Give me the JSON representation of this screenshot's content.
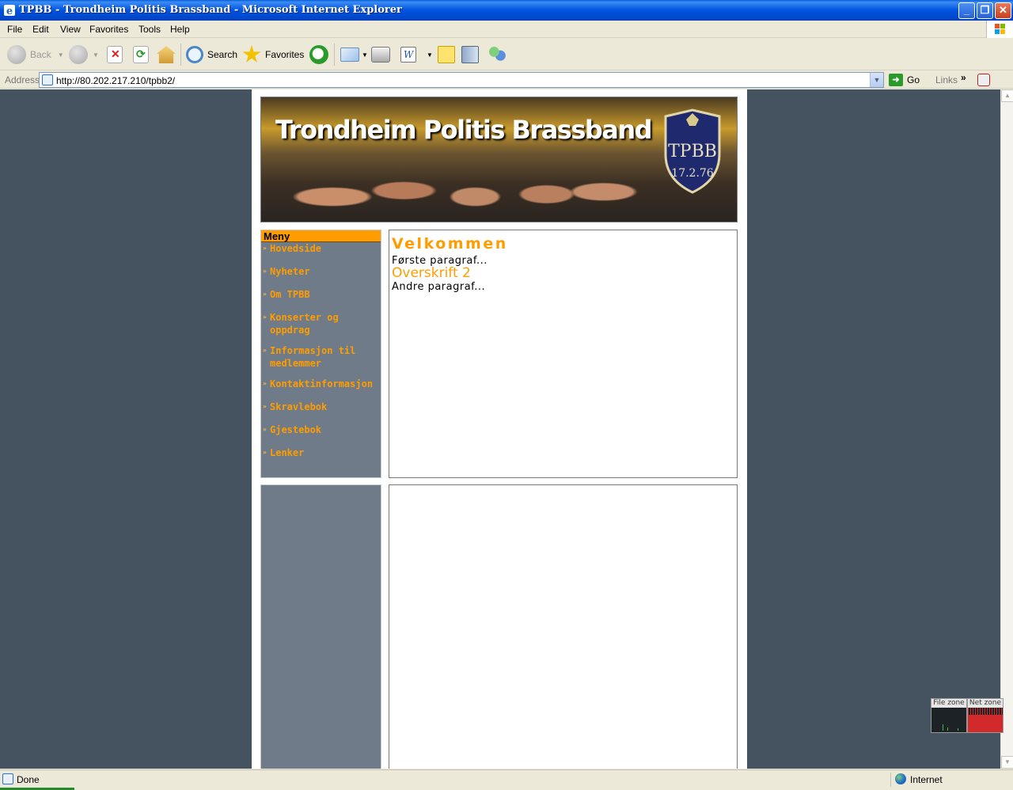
{
  "window": {
    "title": "TPBB - Trondheim Politis Brassband - Microsoft Internet Explorer",
    "min_glyph": "_",
    "max_glyph": "❐",
    "close_glyph": "✕"
  },
  "menubar": {
    "items": [
      "File",
      "Edit",
      "View",
      "Favorites",
      "Tools",
      "Help"
    ]
  },
  "toolbar": {
    "back": "Back",
    "search": "Search",
    "favorites": "Favorites"
  },
  "address": {
    "label": "Address",
    "url": "http://80.202.217.210/tpbb2/",
    "go": "Go",
    "links": "Links",
    "links_chevron": "»"
  },
  "page": {
    "banner": {
      "title": "Trondheim Politis Brassband",
      "crest_abbr": "TPBB",
      "crest_date": "17.2.76"
    },
    "menu": {
      "heading": "Meny",
      "bullet": "»",
      "items": [
        "Hovedside",
        "Nyheter",
        "Om TPBB",
        "Konserter og oppdrag",
        "Informasjon til medlemmer",
        "Kontaktinformasjon",
        "Skravlebok",
        "Gjestebok",
        "Lenker"
      ]
    },
    "content": {
      "heading": "Velkommen",
      "paragraph1": "Første paragraf...",
      "heading2": "Overskrift 2",
      "paragraph2": "Andre paragraf..."
    }
  },
  "zones": {
    "file": "File zone",
    "net": "Net zone"
  },
  "status": {
    "text": "Done",
    "zone": "Internet"
  },
  "colors": {
    "accent_orange": "#ff9d00",
    "page_background": "#455360",
    "menu_background": "#6f7b88"
  }
}
